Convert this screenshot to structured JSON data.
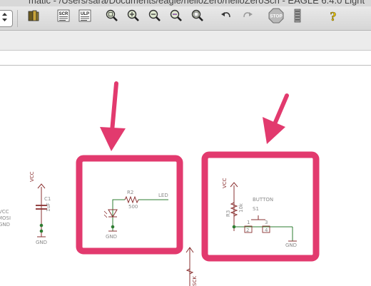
{
  "window": {
    "title": "matic - /Users/sara/Documents/eagle/helloZero/helloZeroSch - EAGLE 6.4.0 Light"
  },
  "toolbar": {
    "buttons": [
      {
        "id": "stepper",
        "icon": "stepper-icon"
      },
      {
        "id": "open-library",
        "icon": "library-book-icon"
      },
      {
        "id": "script",
        "icon": "script-icon",
        "label": "SCR"
      },
      {
        "id": "ulp",
        "icon": "ulp-icon",
        "label": "ULP"
      },
      {
        "id": "zoom-fit",
        "icon": "zoom-fit-icon"
      },
      {
        "id": "zoom-in",
        "icon": "zoom-in-icon"
      },
      {
        "id": "zoom-out",
        "icon": "zoom-out-icon"
      },
      {
        "id": "zoom-select",
        "icon": "zoom-select-icon"
      },
      {
        "id": "redraw",
        "icon": "zoom-redraw-icon"
      },
      {
        "id": "undo",
        "icon": "undo-icon"
      },
      {
        "id": "redo",
        "icon": "redo-icon"
      },
      {
        "id": "stop",
        "icon": "stop-icon",
        "label": "STOP"
      },
      {
        "id": "go",
        "icon": "go-icon"
      },
      {
        "id": "help",
        "icon": "help-icon",
        "label": "?"
      }
    ]
  },
  "schematic": {
    "left_labels": {
      "vcc": "VCC",
      "mosi": "MOSI",
      "gnd": "GND"
    },
    "capacitor": {
      "name": "C1",
      "value": "1uF",
      "supply": "VCC",
      "ground": "GND"
    },
    "led_circuit": {
      "resistor": "R2",
      "resistor_value": "500",
      "net": "LED",
      "ground": "GND"
    },
    "button_circuit": {
      "label": "BUTTON",
      "switch": "S1",
      "supply": "VCC",
      "resistor": "R3",
      "resistor_value": "10k",
      "pin_a": "2",
      "pin_b": "4",
      "pin_c": "1",
      "pin_d": "3",
      "ground": "GND"
    },
    "bottom_net": "SCK"
  },
  "annotation": {
    "color": "#e23a6e"
  }
}
